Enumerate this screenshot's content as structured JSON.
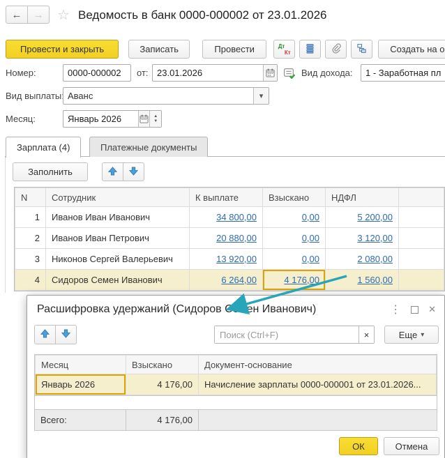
{
  "window": {
    "title": "Ведомость в банк 0000-000002 от 23.01.2026"
  },
  "toolbar": {
    "post_and_close": "Провести и закрыть",
    "write": "Записать",
    "post": "Провести",
    "dt": "Дт",
    "kt": "Кт",
    "create_based_on": "Создать на о"
  },
  "form": {
    "number_label": "Номер:",
    "number_value": "0000-000002",
    "date_label": "от:",
    "date_value": "23.01.2026",
    "income_type_label": "Вид дохода:",
    "income_type_value": "1 - Заработная пл",
    "payment_type_label": "Вид выплаты:",
    "payment_type_value": "Аванс",
    "month_label": "Месяц:",
    "month_value": "Январь 2026"
  },
  "tabs": {
    "salary": "Зарплата (4)",
    "payment_documents": "Платежные документы"
  },
  "commands": {
    "fill": "Заполнить"
  },
  "salary_table": {
    "headers": {
      "n": "N",
      "employee": "Сотрудник",
      "to_pay": "К выплате",
      "collected": "Взыскано",
      "ndfl": "НДФЛ"
    },
    "rows": [
      {
        "n": "1",
        "employee": "Иванов Иван Иванович",
        "to_pay": "34 800,00",
        "collected": "0,00",
        "ndfl": "5 200,00"
      },
      {
        "n": "2",
        "employee": "Иванов Иван Петрович",
        "to_pay": "20 880,00",
        "collected": "0,00",
        "ndfl": "3 120,00"
      },
      {
        "n": "3",
        "employee": "Никонов Сергей Валерьевич",
        "to_pay": "13 920,00",
        "collected": "0,00",
        "ndfl": "2 080,00"
      },
      {
        "n": "4",
        "employee": "Сидоров Семен Иванович",
        "to_pay": "6 264,00",
        "collected": "4 176,00",
        "ndfl": "1 560,00"
      }
    ]
  },
  "dialog": {
    "title": "Расшифровка удержаний (Сидоров Семен Иванович)",
    "search_placeholder": "Поиск (Ctrl+F)",
    "more": "Еще",
    "headers": {
      "month": "Месяц",
      "collected": "Взыскано",
      "base_doc": "Документ-основание"
    },
    "rows": [
      {
        "month": "Январь 2026",
        "collected": "4 176,00",
        "base_doc": "Начисление зарплаты 0000-000001 от 23.01.2026..."
      }
    ],
    "total_label": "Всего:",
    "total_value": "4 176,00",
    "ok": "ОК",
    "cancel": "Отмена"
  },
  "icons": {
    "back": "←",
    "forward": "→",
    "favorite": "☆",
    "dropdown": "▾",
    "spin_up": "▲",
    "spin_down": "▼",
    "kebab": "⋮",
    "close": "✕",
    "search_clear": "×"
  },
  "colors": {
    "accent_yellow": "#f5d728",
    "selection_border": "#dca500",
    "row_highlight": "#f6efcd",
    "link_blue": "#2e6cb0",
    "annotation_arrow": "#29a5ba"
  }
}
